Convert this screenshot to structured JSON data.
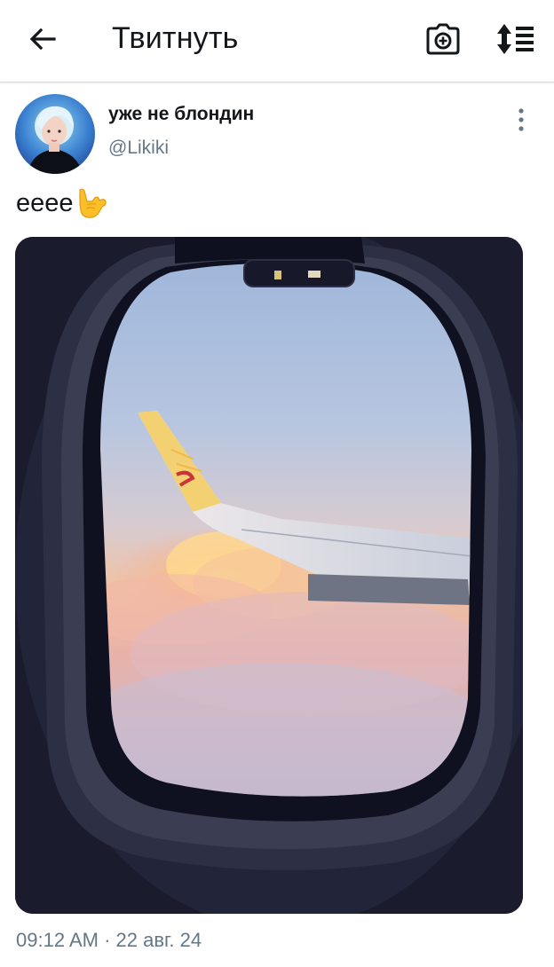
{
  "header": {
    "title": "Твитнуть",
    "back_icon": "arrow-left-icon",
    "camera_icon": "camera-plus-icon",
    "sort_icon": "sort-list-icon"
  },
  "tweet": {
    "display_name": "уже не блондин",
    "handle": "@Likiki",
    "text": "eeee",
    "emoji": "sign-of-horns-emoji",
    "time": "09:12 AM",
    "separator": "·",
    "date": "22 авг. 24",
    "media_description_icon": "airplane-window-photo"
  },
  "colors": {
    "text_primary": "#14171a",
    "text_secondary": "#657786",
    "divider": "#d9d9d9"
  }
}
